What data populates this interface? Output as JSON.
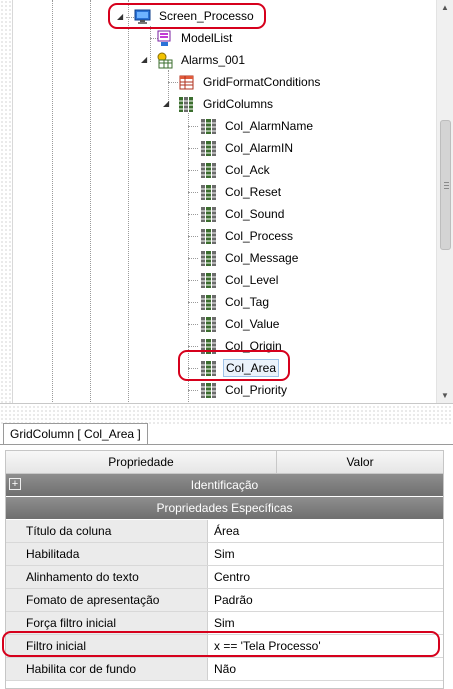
{
  "tree": {
    "nodes": [
      {
        "label": "Screen_Processo",
        "icon": "monitor-icon"
      },
      {
        "label": "ModelList",
        "icon": "model-list-icon"
      },
      {
        "label": "Alarms_001",
        "icon": "alarm-grid-icon"
      },
      {
        "label": "GridFormatConditions",
        "icon": "grid-format-icon"
      },
      {
        "label": "GridColumns",
        "icon": "grid-columns-icon"
      },
      {
        "label": "Col_AlarmName",
        "icon": "column-icon"
      },
      {
        "label": "Col_AlarmIN",
        "icon": "column-icon"
      },
      {
        "label": "Col_Ack",
        "icon": "column-icon"
      },
      {
        "label": "Col_Reset",
        "icon": "column-icon"
      },
      {
        "label": "Col_Sound",
        "icon": "column-icon"
      },
      {
        "label": "Col_Process",
        "icon": "column-icon"
      },
      {
        "label": "Col_Message",
        "icon": "column-icon"
      },
      {
        "label": "Col_Level",
        "icon": "column-icon"
      },
      {
        "label": "Col_Tag",
        "icon": "column-icon"
      },
      {
        "label": "Col_Value",
        "icon": "column-icon"
      },
      {
        "label": "Col_Origin",
        "icon": "column-icon"
      },
      {
        "label": "Col_Area",
        "icon": "column-icon"
      },
      {
        "label": "Col_Priority",
        "icon": "column-icon"
      }
    ]
  },
  "properties": {
    "tab_label": "GridColumn [ Col_Area ]",
    "header_name": "Propriedade",
    "header_value": "Valor",
    "category_identification": "Identificação",
    "category_specific": "Propriedades Específicas",
    "rows": [
      {
        "name": "Título da coluna",
        "value": "Área"
      },
      {
        "name": "Habilitada",
        "value": "Sim"
      },
      {
        "name": "Alinhamento do texto",
        "value": "Centro"
      },
      {
        "name": "Fomato de apresentação",
        "value": "Padrão"
      },
      {
        "name": "Força filtro inicial",
        "value": "Sim"
      },
      {
        "name": "Filtro inicial",
        "value": "x == 'Tela Processo'"
      },
      {
        "name": "Habilita cor de fundo",
        "value": "Não"
      }
    ]
  },
  "colors": {
    "highlight": "#d6001c",
    "selection": "#eaf2fb",
    "category": "#7a7a7a"
  }
}
